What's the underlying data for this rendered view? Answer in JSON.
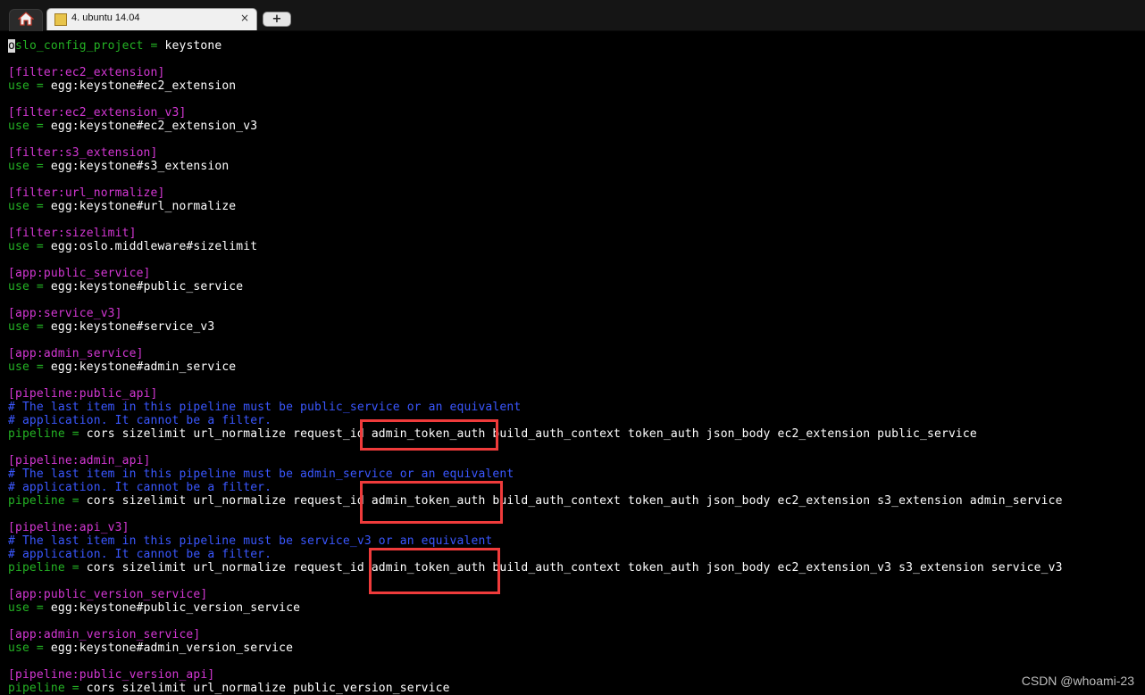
{
  "window": {
    "home_icon": "home-icon",
    "tab": {
      "icon": "terminal-session-icon",
      "title": "4. ubuntu 14.04",
      "close": "×"
    },
    "new_tab": "+"
  },
  "terminal": {
    "lines": [
      {
        "cursor": "o",
        "key": "slo_config_project",
        "eq": " = ",
        "val": "keystone"
      },
      {
        "type": "blank"
      },
      {
        "type": "section",
        "text": "[filter:ec2_extension]"
      },
      {
        "key": "use",
        "eq": " = ",
        "val": "egg:keystone#ec2_extension"
      },
      {
        "type": "blank"
      },
      {
        "type": "section",
        "text": "[filter:ec2_extension_v3]"
      },
      {
        "key": "use",
        "eq": " = ",
        "val": "egg:keystone#ec2_extension_v3"
      },
      {
        "type": "blank"
      },
      {
        "type": "section",
        "text": "[filter:s3_extension]"
      },
      {
        "key": "use",
        "eq": " = ",
        "val": "egg:keystone#s3_extension"
      },
      {
        "type": "blank"
      },
      {
        "type": "section",
        "text": "[filter:url_normalize]"
      },
      {
        "key": "use",
        "eq": " = ",
        "val": "egg:keystone#url_normalize"
      },
      {
        "type": "blank"
      },
      {
        "type": "section",
        "text": "[filter:sizelimit]"
      },
      {
        "key": "use",
        "eq": " = ",
        "val": "egg:oslo.middleware#sizelimit"
      },
      {
        "type": "blank"
      },
      {
        "type": "section",
        "text": "[app:public_service]"
      },
      {
        "key": "use",
        "eq": " = ",
        "val": "egg:keystone#public_service"
      },
      {
        "type": "blank"
      },
      {
        "type": "section",
        "text": "[app:service_v3]"
      },
      {
        "key": "use",
        "eq": " = ",
        "val": "egg:keystone#service_v3"
      },
      {
        "type": "blank"
      },
      {
        "type": "section",
        "text": "[app:admin_service]"
      },
      {
        "key": "use",
        "eq": " = ",
        "val": "egg:keystone#admin_service"
      },
      {
        "type": "blank"
      },
      {
        "type": "section",
        "text": "[pipeline:public_api]"
      },
      {
        "type": "comment",
        "text": "# The last item in this pipeline must be public_service or an equivalent"
      },
      {
        "type": "comment",
        "text": "# application. It cannot be a filter."
      },
      {
        "key": "pipeline",
        "eq": " = ",
        "val": "cors sizelimit url_normalize request_id admin_token_auth build_auth_context token_auth json_body ec2_extension public_service"
      },
      {
        "type": "blank"
      },
      {
        "type": "section",
        "text": "[pipeline:admin_api]"
      },
      {
        "type": "comment",
        "text": "# The last item in this pipeline must be admin_service or an equivalent"
      },
      {
        "type": "comment",
        "text": "# application. It cannot be a filter."
      },
      {
        "key": "pipeline",
        "eq": " = ",
        "val": "cors sizelimit url_normalize request_id admin_token_auth build_auth_context token_auth json_body ec2_extension s3_extension admin_service"
      },
      {
        "type": "blank"
      },
      {
        "type": "section",
        "text": "[pipeline:api_v3]"
      },
      {
        "type": "comment",
        "text": "# The last item in this pipeline must be service_v3 or an equivalent"
      },
      {
        "type": "comment",
        "text": "# application. It cannot be a filter."
      },
      {
        "key": "pipeline",
        "eq": " = ",
        "val": "cors sizelimit url_normalize request_id admin_token_auth build_auth_context token_auth json_body ec2_extension_v3 s3_extension service_v3"
      },
      {
        "type": "blank"
      },
      {
        "type": "section",
        "text": "[app:public_version_service]"
      },
      {
        "key": "use",
        "eq": " = ",
        "val": "egg:keystone#public_version_service"
      },
      {
        "type": "blank"
      },
      {
        "type": "section",
        "text": "[app:admin_version_service]"
      },
      {
        "key": "use",
        "eq": " = ",
        "val": "egg:keystone#admin_version_service"
      },
      {
        "type": "blank"
      },
      {
        "type": "section",
        "text": "[pipeline:public_version_api]"
      },
      {
        "key": "pipeline",
        "eq": " = ",
        "val": "cors sizelimit url_normalize public_version_service"
      }
    ],
    "highlight_token": "admin_token_auth",
    "colors": {
      "key": "#24b324",
      "value": "#ffffff",
      "section": "#d337d3",
      "comment": "#3a57ff",
      "highlight_box": "#ef3b3b",
      "background": "#000000"
    }
  },
  "watermark": "CSDN @whoami-23"
}
